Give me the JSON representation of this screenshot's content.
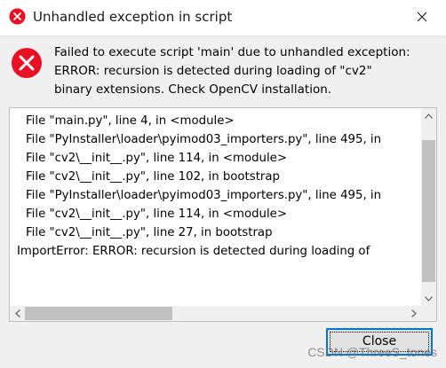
{
  "window": {
    "title": "Unhandled exception in script",
    "title_icon": "error-icon",
    "close_icon": "close-icon"
  },
  "message": {
    "icon": "error-icon",
    "text": "Failed to execute script 'main' due to unhandled exception:\nERROR: recursion is detected during loading of \"cv2\"\nbinary extensions. Check OpenCV installation."
  },
  "traceback": {
    "lines": [
      "File \"main.py\", line 4, in <module>",
      "File \"PyInstaller\\loader\\pyimod03_importers.py\", line 495, in",
      "File \"cv2\\__init__.py\", line 114, in <module>",
      "File \"cv2\\__init__.py\", line 102, in bootstrap",
      "File \"PyInstaller\\loader\\pyimod03_importers.py\", line 495, in",
      "File \"cv2\\__init__.py\", line 114, in <module>",
      "File \"cv2\\__init__.py\", line 27, in bootstrap",
      "ImportError: ERROR: recursion is detected during loading of"
    ],
    "indent": [
      true,
      true,
      true,
      true,
      true,
      true,
      true,
      false
    ]
  },
  "buttons": {
    "close_label": "Close"
  },
  "watermark": "CSDN @ThreeS_tones",
  "colors": {
    "error_red": "#e81123",
    "focus_border": "#0078d7",
    "scroll_thumb": "#c1c1c1"
  }
}
